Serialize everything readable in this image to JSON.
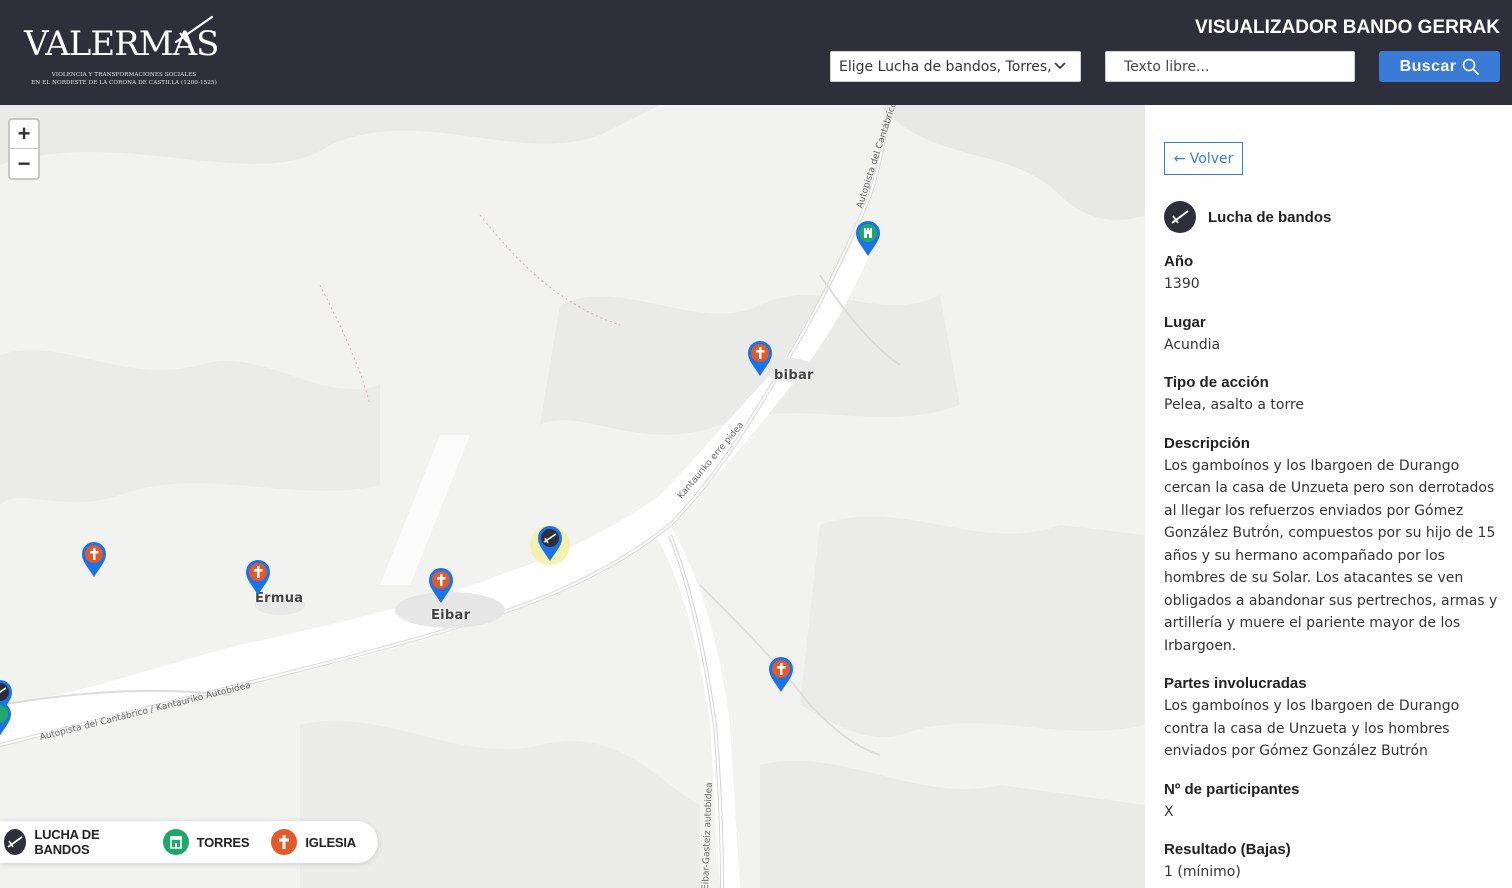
{
  "header": {
    "logo_text": "VALERMAS",
    "logo_subtitle_1": "VIOLENCIA Y TRANSFORMACIONES SOCIALES",
    "logo_subtitle_2": "EN EL NORDESTE DE LA CORONA DE CASTILLA (1200-1525)",
    "title": "VISUALIZADOR BANDO GERRAK",
    "select_value": "Elige Lucha de bandos, Torres,",
    "search_placeholder": "Texto libre...",
    "search_button": "Buscar"
  },
  "map": {
    "zoom_in": "+",
    "zoom_out": "−",
    "places": [
      {
        "name": "Ermua"
      },
      {
        "name": "Eibar"
      },
      {
        "name": "bibar"
      }
    ],
    "roads": [
      {
        "name": "Autopista del Cantábrico"
      },
      {
        "name": "Kantauriko erre pidea"
      },
      {
        "name": "Autopista del Cantábrico / Kantauriko Autobidea"
      },
      {
        "name": "Eibar-Gasteiz autobidea"
      }
    ],
    "marker_types": {
      "lucha": {
        "color": "#2e2f3b",
        "icon": "sword-icon"
      },
      "torres": {
        "color": "#1fa86a",
        "icon": "tower-icon"
      },
      "iglesia": {
        "color": "#e05a2b",
        "icon": "cross-icon"
      }
    },
    "legend": [
      {
        "label": "LUCHA DE BANDOS",
        "icon": "sword-icon",
        "color": "#2e2f3b"
      },
      {
        "label": "TORRES",
        "icon": "tower-icon",
        "color": "#1fa86a"
      },
      {
        "label": "IGLESIA",
        "icon": "cross-icon",
        "color": "#e05a2b"
      }
    ]
  },
  "panel": {
    "back_label": "← Volver",
    "type_label": "Lucha de bandos",
    "fields": [
      {
        "label": "Año",
        "value": "1390"
      },
      {
        "label": "Lugar",
        "value": "Acundia"
      },
      {
        "label": "Tipo de acción",
        "value": "Pelea, asalto a torre"
      },
      {
        "label": "Descripción",
        "value": "Los gamboínos y los Ibargoen de Durango cercan la casa de Unzueta pero son derrotados al llegar los refuerzos enviados por Gómez González Butrón, compuestos por su hijo de 15 años y su hermano acompañado por los hombres de su Solar. Los atacantes se ven obligados a abandonar sus pertrechos, armas y artillería y muere el pariente mayor de los Irbargoen."
      },
      {
        "label": "Partes involucradas",
        "value": "Los gamboínos y los Ibargoen de Durango contra la casa de Unzueta y los hombres enviados por Gómez González Butrón"
      },
      {
        "label": "Nº de participantes",
        "value": "X"
      },
      {
        "label": "Resultado (Bajas)",
        "value": "1 (mínimo)"
      }
    ]
  }
}
